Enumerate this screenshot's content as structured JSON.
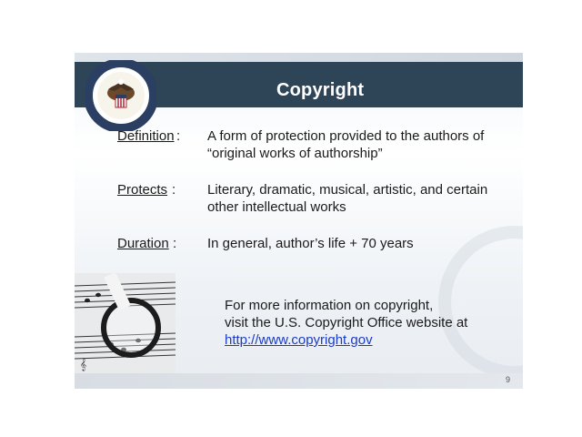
{
  "slide": {
    "title": "Copyright",
    "rows": [
      {
        "label": "Definition",
        "sep": ":",
        "text_line1": "A form of protection provided to the authors of",
        "text_line2": "“original works of authorship”"
      },
      {
        "label": "Protects",
        "sep": ":",
        "text_line1": "Literary, dramatic, musical, artistic, and certain",
        "text_line2": "other intellectual works"
      },
      {
        "label": "Duration",
        "sep": ":",
        "text_line1": "In general, author’s life + 70 years"
      }
    ],
    "info": {
      "line1": "For more information on copyright,",
      "line2": "visit the U.S. Copyright Office website at",
      "link": "http://www.copyright.gov"
    },
    "page_number": "9"
  },
  "colors": {
    "header": "#2e4457",
    "link": "#1a3cc8"
  }
}
